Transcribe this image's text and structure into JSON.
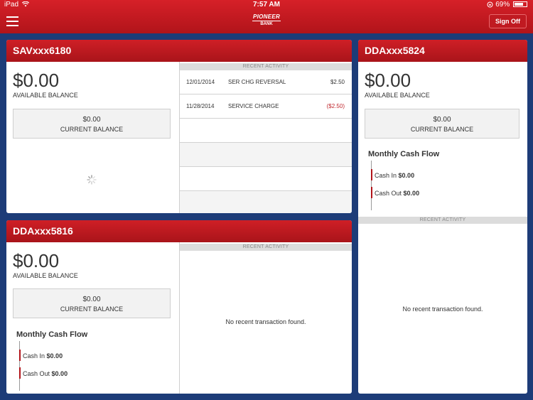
{
  "status_bar": {
    "device": "iPad",
    "time": "7:57 AM",
    "battery": "69%"
  },
  "navbar": {
    "logo_line1": "PIONEER",
    "logo_line2": "BANK",
    "sign_off": "Sign Off"
  },
  "accounts": [
    {
      "name": "SAVxxx6180",
      "available_amount": "$0.00",
      "available_label": "AVAILABLE BALANCE",
      "current_amount": "$0.00",
      "current_label": "CURRENT BALANCE",
      "recent_activity_label": "RECENT ACTIVITY",
      "transactions": [
        {
          "date": "12/01/2014",
          "description": "SER CHG REVERSAL",
          "amount": "$2.50",
          "negative": false
        },
        {
          "date": "11/28/2014",
          "description": "SERVICE CHARGE",
          "amount": "($2.50)",
          "negative": true
        }
      ]
    },
    {
      "name": "DDAxxx5816",
      "available_amount": "$0.00",
      "available_label": "AVAILABLE BALANCE",
      "current_amount": "$0.00",
      "current_label": "CURRENT BALANCE",
      "monthly_cash_flow_label": "Monthly Cash Flow",
      "cash_in_label": "Cash In",
      "cash_in_value": "$0.00",
      "cash_out_label": "Cash Out",
      "cash_out_value": "$0.00",
      "recent_activity_label": "RECENT ACTIVITY",
      "no_transactions": "No recent transaction found."
    },
    {
      "name": "DDAxxx5824",
      "available_amount": "$0.00",
      "available_label": "AVAILABLE BALANCE",
      "current_amount": "$0.00",
      "current_label": "CURRENT BALANCE",
      "monthly_cash_flow_label": "Monthly Cash Flow",
      "cash_in_label": "Cash In",
      "cash_in_value": "$0.00",
      "cash_out_label": "Cash Out",
      "cash_out_value": "$0.00",
      "recent_activity_label": "RECENT ACTIVITY",
      "no_transactions": "No recent transaction found."
    }
  ],
  "colors": {
    "brand_red": "#c01a21",
    "background_navy": "#1d3c78",
    "negative_amount": "#c0282e"
  },
  "icons": {
    "menu": "hamburger-menu-icon",
    "loading": "loading-spinner-icon",
    "wifi": "wifi-icon",
    "battery": "battery-icon"
  }
}
